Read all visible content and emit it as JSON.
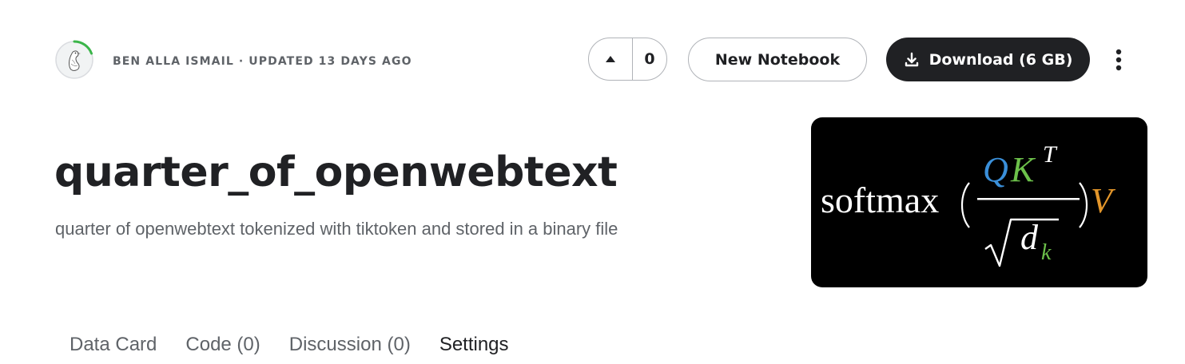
{
  "header": {
    "owner_line": "BEN ALLA ISMAIL · UPDATED 13 DAYS AGO",
    "vote_count": "0",
    "new_notebook_label": "New Notebook",
    "download_label": "Download (6 GB)",
    "avatar_ring_color": "#20BEFF",
    "accent_color": "#3BB54A"
  },
  "dataset": {
    "title": "quarter_of_openwebtext",
    "subtitle": "quarter of openwebtext tokenized with tiktoken and stored in a binary file"
  },
  "cover_image": {
    "formula_prefix": "softmax",
    "numerator_q": "Q",
    "numerator_k": "K",
    "superscript_t": "T",
    "denominator_d": "d",
    "subscript_k": "k",
    "trailing_v": "V",
    "colors": {
      "q": "#3A8FD9",
      "k": "#6CC04A",
      "v": "#E3962A",
      "text": "#FFFFFF",
      "background": "#000000"
    }
  },
  "tabs": [
    {
      "label": "Data Card"
    },
    {
      "label": "Code (0)"
    },
    {
      "label": "Discussion (0)"
    },
    {
      "label": "Settings"
    }
  ],
  "icons": {
    "upvote": "triangle-up-icon",
    "download": "download-icon",
    "more": "vertical-dots-icon"
  }
}
